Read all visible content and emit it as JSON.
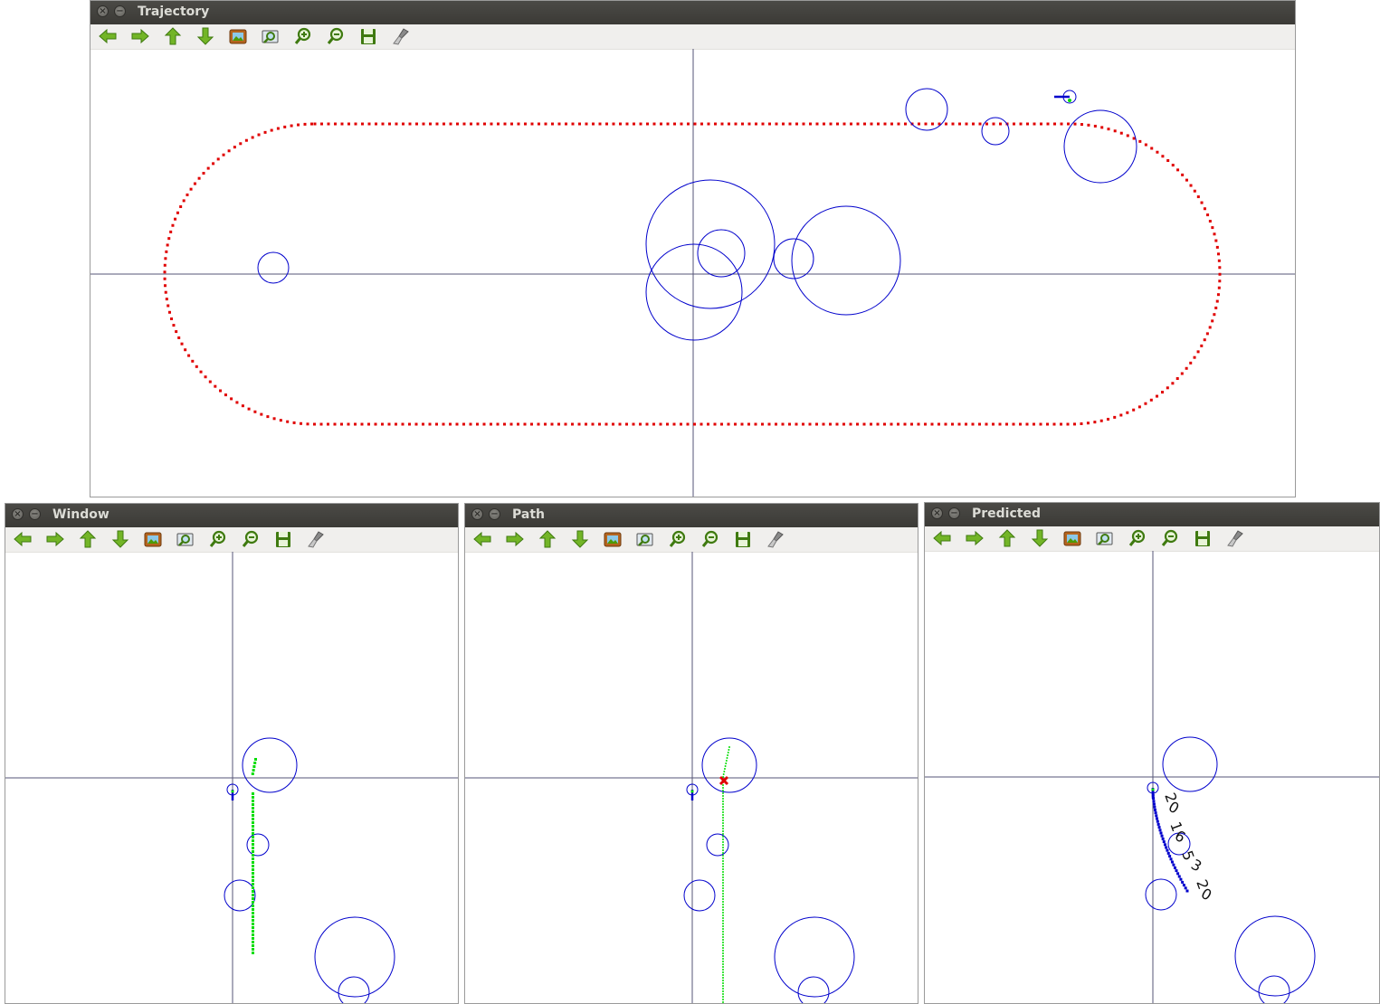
{
  "windows": {
    "trajectory": {
      "title": "Trajectory"
    },
    "window": {
      "title": "Window"
    },
    "path": {
      "title": "Path"
    },
    "predicted": {
      "title": "Predicted"
    }
  },
  "toolbar": {
    "buttons": [
      {
        "icon": "arrow-left-icon",
        "label": "Pan left"
      },
      {
        "icon": "arrow-right-icon",
        "label": "Pan right"
      },
      {
        "icon": "arrow-up-icon",
        "label": "Pan up"
      },
      {
        "icon": "arrow-down-icon",
        "label": "Pan down"
      },
      {
        "icon": "image-icon",
        "label": "Zoom to original size"
      },
      {
        "icon": "zoom-fit-icon",
        "label": "Zoom to fit"
      },
      {
        "icon": "zoom-in-icon",
        "label": "Zoom in"
      },
      {
        "icon": "zoom-out-icon",
        "label": "Zoom out"
      },
      {
        "icon": "save-icon",
        "label": "Save"
      },
      {
        "icon": "brush-icon",
        "label": "Properties"
      }
    ]
  },
  "predicted_labels": [
    "2",
    "0",
    "1",
    "6",
    "5",
    "3",
    "2",
    "0"
  ],
  "colors": {
    "trajectory": "#e00000",
    "obstacle": "#0000cc",
    "path": "#00dd00",
    "predicted": "#0000cc",
    "axis": "#555577",
    "titlebar": "#3f3e3a",
    "icon_green": "#4e9a06"
  }
}
